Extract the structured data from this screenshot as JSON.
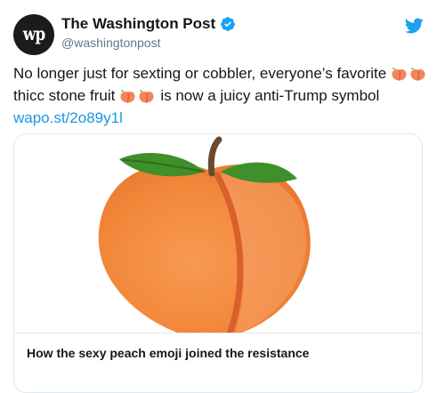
{
  "author": {
    "display_name": "The Washington Post",
    "handle": "@washingtonpost",
    "avatar_text": "wp",
    "verified": true
  },
  "tweet": {
    "text_line1": "No longer just for sexting or cobbler, everyone’s favorite",
    "text_line2_a": "thicc stone fruit",
    "text_line2_b": "is now a juicy anti-Trump symbol",
    "link": "wapo.st/2o89y1l"
  },
  "card": {
    "title": "How the sexy peach emoji joined the resistance",
    "image_icon": "peach-emoji-icon"
  },
  "icons": {
    "verified": "verified-badge-icon",
    "platform": "twitter-bird-icon",
    "emoji": "peach-emoji-icon"
  },
  "colors": {
    "link": "#1b95e0",
    "verified": "#1da1f2",
    "twitter_bird": "#1da1f2",
    "peach_main": "#f28b3c",
    "peach_leaf": "#3f8f2b",
    "text": "#14171a",
    "secondary_text": "#657786"
  }
}
